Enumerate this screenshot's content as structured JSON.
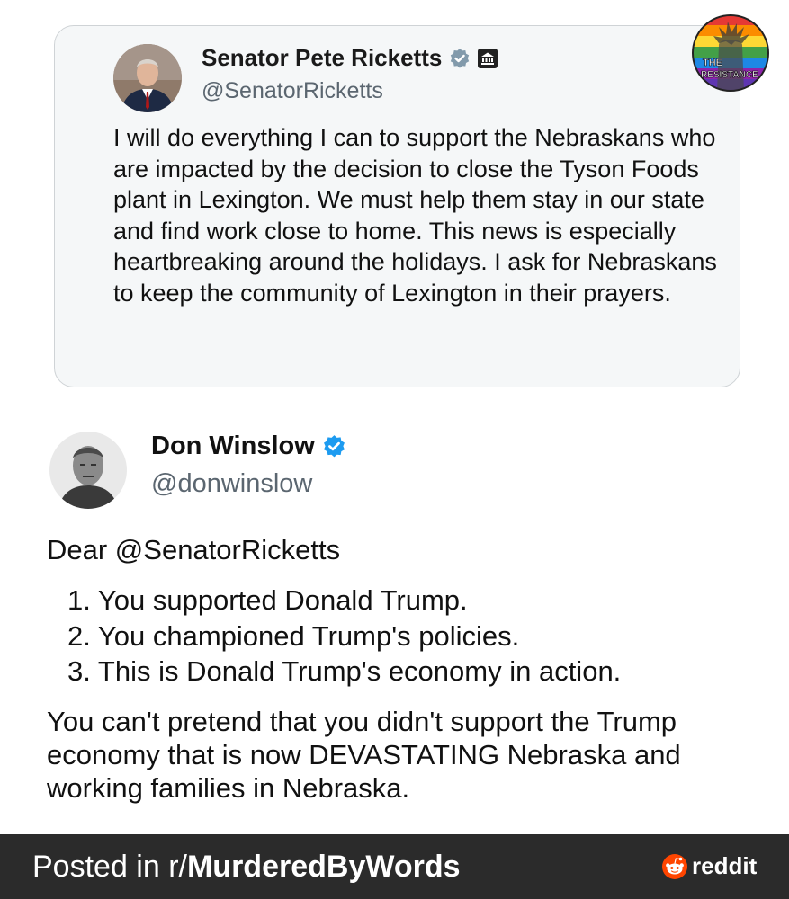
{
  "quoted_tweet": {
    "author_name": "Senator Pete Ricketts",
    "author_handle": "@SenatorRicketts",
    "verified_icon": "verified-badge-gray-icon",
    "affiliation_icon": "government-building-icon",
    "text": "I will do everything I can to support the Nebraskans who are impacted by the decision to close the Tyson Foods plant in Lexington. We must help them stay in our state and find work close to home. This news is especially heartbreaking around the holidays. I ask for Nebraskans to keep the community of Lexington in their prayers."
  },
  "badge": {
    "line1": "THE",
    "line2": "RESISTANCE"
  },
  "reply_tweet": {
    "author_name": "Don Winslow",
    "author_handle": "@donwinslow",
    "verified_icon": "verified-badge-blue-icon",
    "salutation": "Dear @SenatorRicketts",
    "list_items": [
      "1. You supported Donald Trump.",
      "2. You championed Trump's policies.",
      "3. This is Donald Trump's economy in action."
    ],
    "closing": "You can't pretend that you didn't support the Trump economy that is now DEVASTATING Nebraska and working families in Nebraska."
  },
  "footer": {
    "posted_prefix": "Posted in r/",
    "subreddit": "MurderedByWords",
    "brand": "reddit",
    "brand_icon": "reddit-snoo-icon"
  },
  "colors": {
    "verified_blue": "#1d9bf0",
    "verified_gray": "#829aab",
    "footer_bg": "#2b2b2b",
    "reddit_orange": "#ff4500"
  }
}
